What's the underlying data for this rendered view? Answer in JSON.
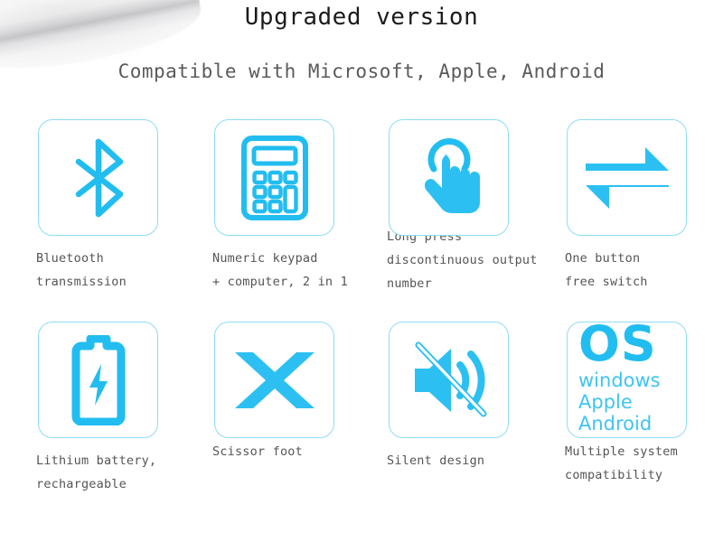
{
  "colors": {
    "accent": "#22bdf0",
    "accent_light": "#3fc4f2",
    "card_border": "#8fdcf5",
    "title_text": "#1b1b1b",
    "body_text": "#555555",
    "background": "#ffffff"
  },
  "header": {
    "title": "Upgraded version",
    "subtitle": "Compatible with Microsoft, Apple, Android"
  },
  "features": [
    {
      "icon": "bluetooth-icon",
      "label": "Bluetooth\ntransmission"
    },
    {
      "icon": "calculator-icon",
      "label": "Numeric keypad\n+ computer, 2 in 1"
    },
    {
      "icon": "long-press-hand-icon",
      "label": "Long press\ndiscontinuous output\nnumber"
    },
    {
      "icon": "swap-arrows-icon",
      "label": "One button\nfree switch"
    },
    {
      "icon": "battery-charging-icon",
      "label": "Lithium battery,\nrechargeable"
    },
    {
      "icon": "scissor-x-icon",
      "label": "Scissor foot"
    },
    {
      "icon": "mute-speaker-icon",
      "label": "Silent design"
    },
    {
      "icon": "os-logo-icon",
      "label": "Multiple system\ncompatibility"
    }
  ],
  "os_card": {
    "heading": "OS",
    "systems": "windows\nApple\nAndroid"
  }
}
